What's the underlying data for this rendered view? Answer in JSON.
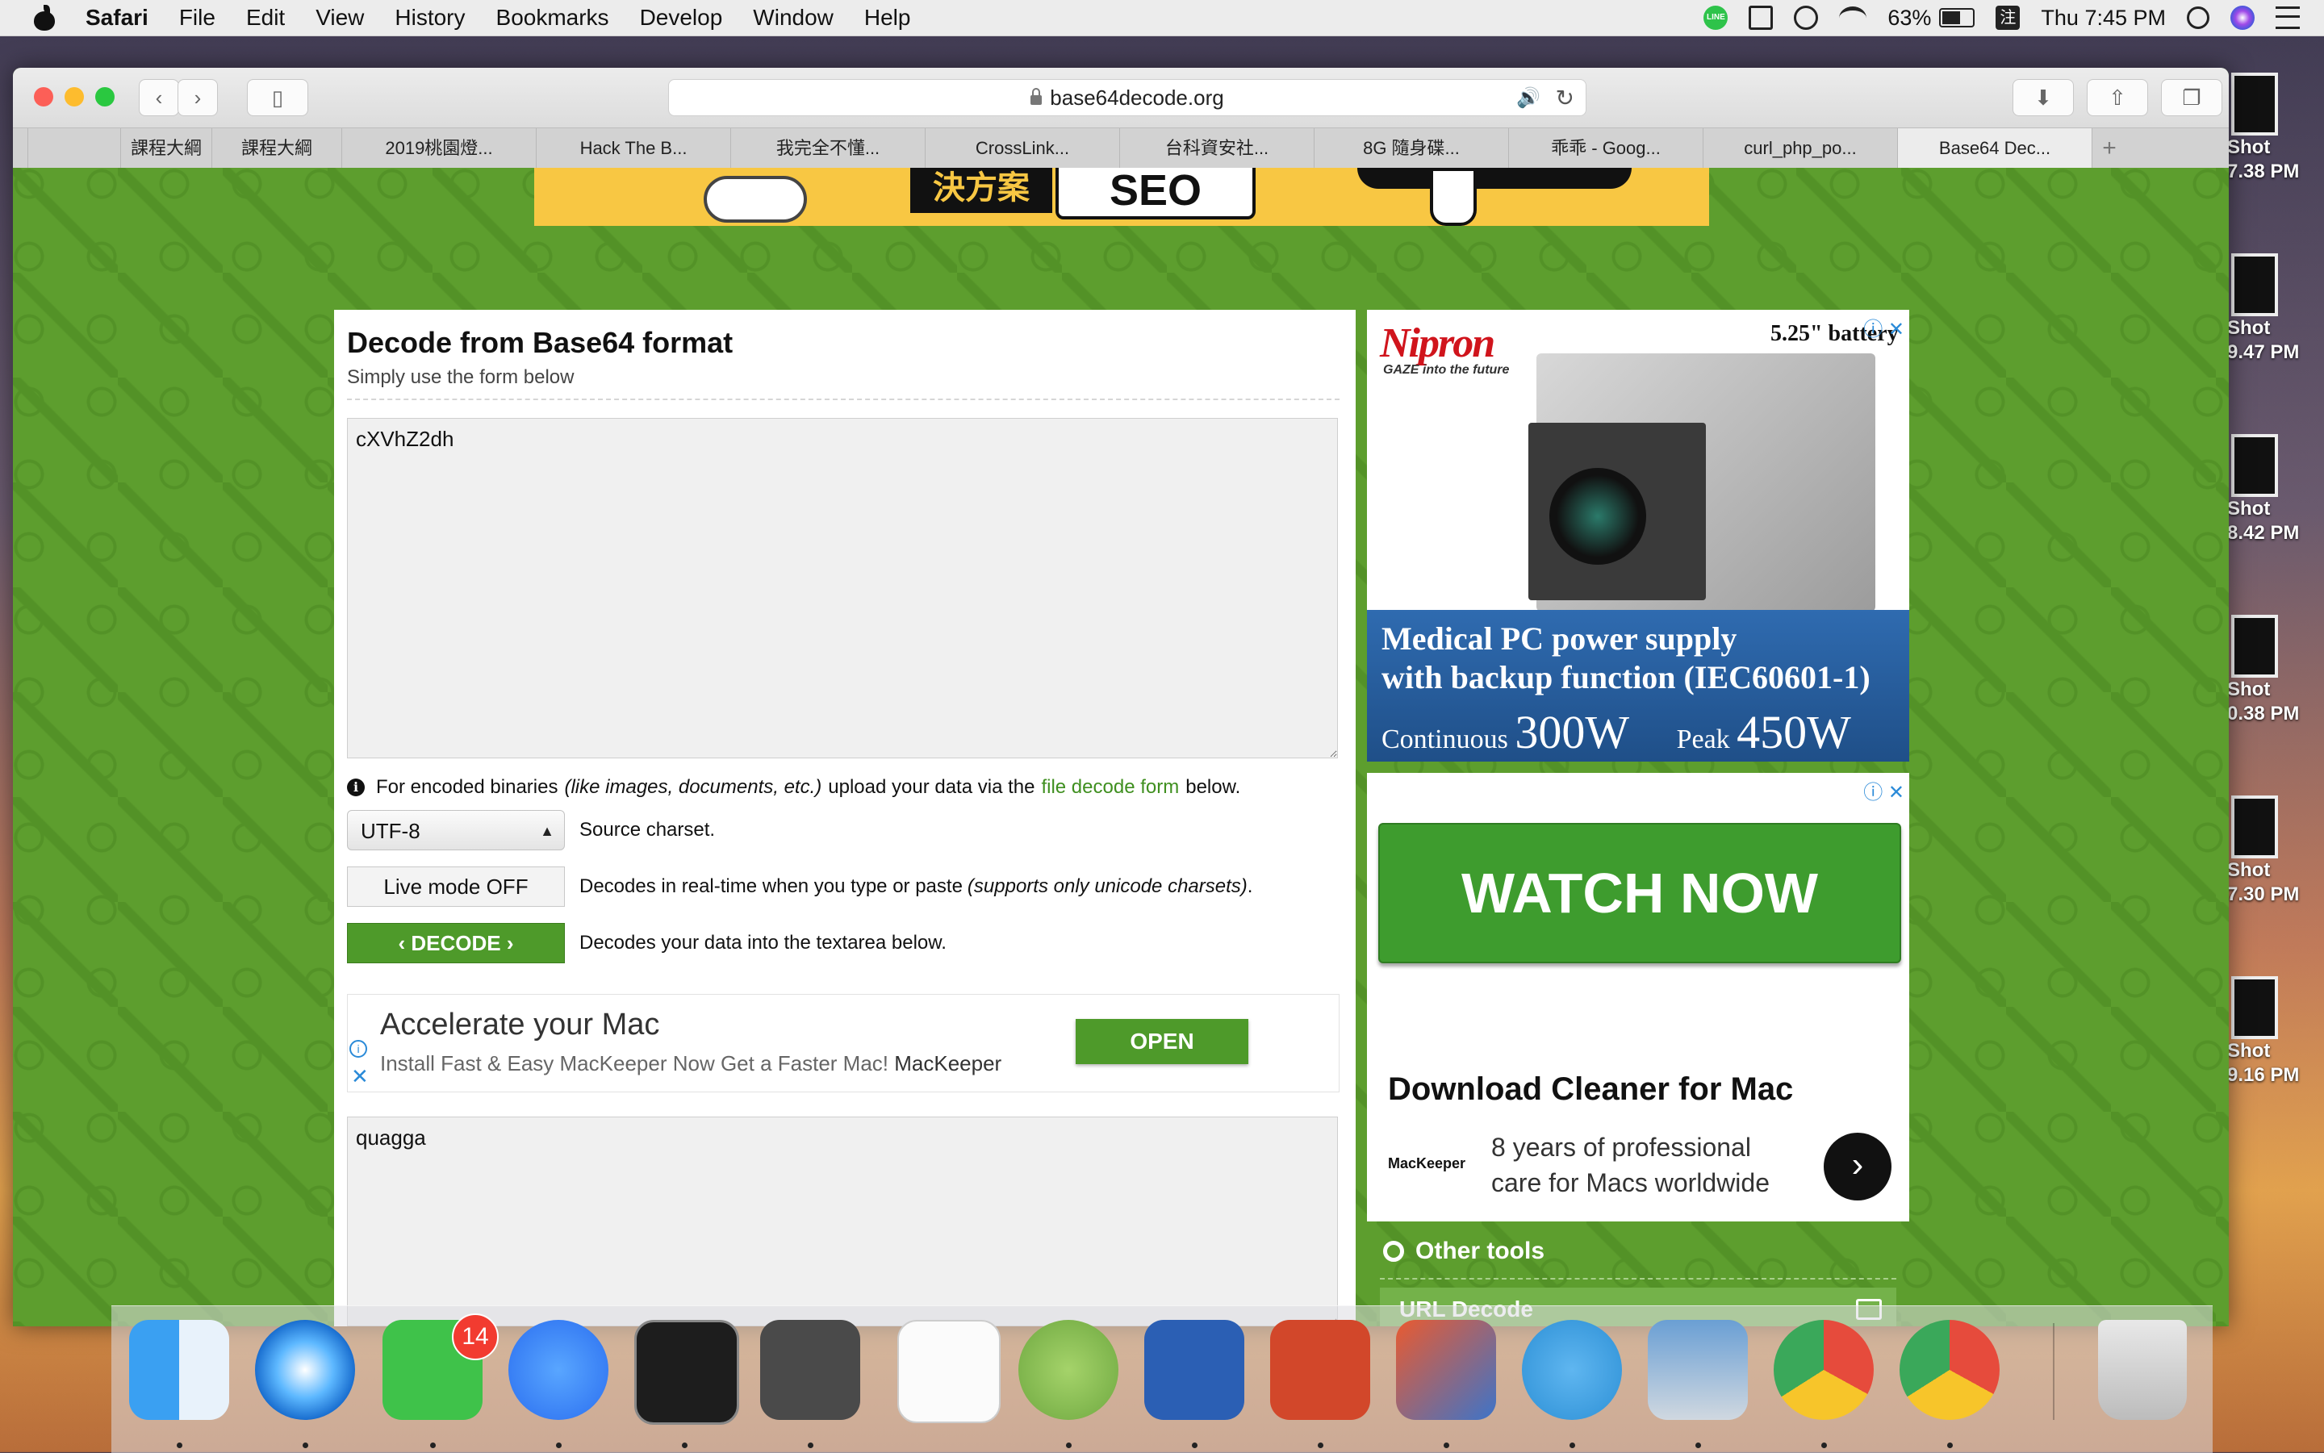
{
  "menubar": {
    "app": "Safari",
    "items": [
      "File",
      "Edit",
      "View",
      "History",
      "Bookmarks",
      "Develop",
      "Window",
      "Help"
    ],
    "status": {
      "battery": "63%",
      "time": "Thu 7:45 PM",
      "ime": "注",
      "line_label": "LINE"
    }
  },
  "desktop": {
    "shots": [
      {
        "name": "Shot",
        "time": "7.38 PM"
      },
      {
        "name": "Shot",
        "time": "9.47 PM"
      },
      {
        "name": "Shot",
        "time": "8.42 PM"
      },
      {
        "name": "Shot",
        "time": "0.38 PM"
      },
      {
        "name": "Shot",
        "time": "7.30 PM"
      },
      {
        "name": "Shot",
        "time": "9.16 PM"
      }
    ]
  },
  "browser": {
    "url": "base64decode.org",
    "tabs": [
      {
        "label": "",
        "active": false
      },
      {
        "label": "",
        "active": false
      },
      {
        "label": "課程大綱",
        "active": false
      },
      {
        "label": "課程大綱",
        "active": false
      },
      {
        "label": "2019桃園燈...",
        "active": false
      },
      {
        "label": "Hack The B...",
        "active": false
      },
      {
        "label": "我完全不懂...",
        "active": false
      },
      {
        "label": "CrossLink...",
        "active": false
      },
      {
        "label": "台科資安社...",
        "active": false
      },
      {
        "label": "8G 隨身碟...",
        "active": false
      },
      {
        "label": "乖乖 - Goog...",
        "active": false
      },
      {
        "label": "curl_php_po...",
        "active": false
      },
      {
        "label": "Base64 Dec...",
        "active": true
      },
      {
        "label": "+",
        "active": false
      }
    ]
  },
  "banner": {
    "dark_text": "決方案",
    "seo_text": "SEO"
  },
  "form": {
    "title": "Decode from Base64 format",
    "subtitle": "Simply use the form below",
    "input_value": "cXVhZ2dh",
    "info": {
      "pre": "For encoded binaries",
      "italic": "(like images, documents, etc.)",
      "mid": "upload your data via the",
      "link": "file decode form",
      "post": "below."
    },
    "charset": {
      "value": "UTF-8",
      "desc": "Source charset."
    },
    "live_mode": {
      "label": "Live mode OFF",
      "desc": "Decodes in real-time when you type or paste",
      "desc_italic": "(supports only unicode charsets)",
      "desc_end": "."
    },
    "decode": {
      "label": "DECODE",
      "desc": "Decodes your data into the textarea below."
    },
    "output_value": "quagga"
  },
  "inline_ad": {
    "headline": "Accelerate your Mac",
    "text": "Install Fast & Easy MacKeeper Now Get a Faster Mac!",
    "brand": "MacKeeper",
    "button": "OPEN"
  },
  "side_ad1": {
    "brand": "Nipron",
    "tagline": "GAZE into the future",
    "battery": "5.25\" battery",
    "line1": "Medical PC power supply",
    "line2": "with backup function (IEC60601-1)",
    "continuous_label": "Continuous",
    "continuous_value": "300W",
    "peak_label": "Peak",
    "peak_value": "450W"
  },
  "side_ad2": {
    "button": "WATCH NOW",
    "headline": "Download Cleaner for Mac",
    "brand": "MacKeeper",
    "desc1": "8 years of professional",
    "desc2": "care for Macs worldwide"
  },
  "other_tools": {
    "title": "Other tools",
    "items": [
      "URL Decode"
    ]
  },
  "dock": {
    "line_badge": "14",
    "apps": [
      "Finder",
      "Safari",
      "LINE",
      "Messenger",
      "Terminal",
      "Sublime Text",
      "TextEdit",
      "Android Studio",
      "Word",
      "PowerPoint",
      "Parallels",
      "Telegram",
      "Preview",
      "Chrome",
      "Chrome",
      "Trash"
    ]
  },
  "colors": {
    "site_green": "#5d9e2e",
    "button_green": "#4e9a2a",
    "link_green": "#3f8f1f"
  }
}
